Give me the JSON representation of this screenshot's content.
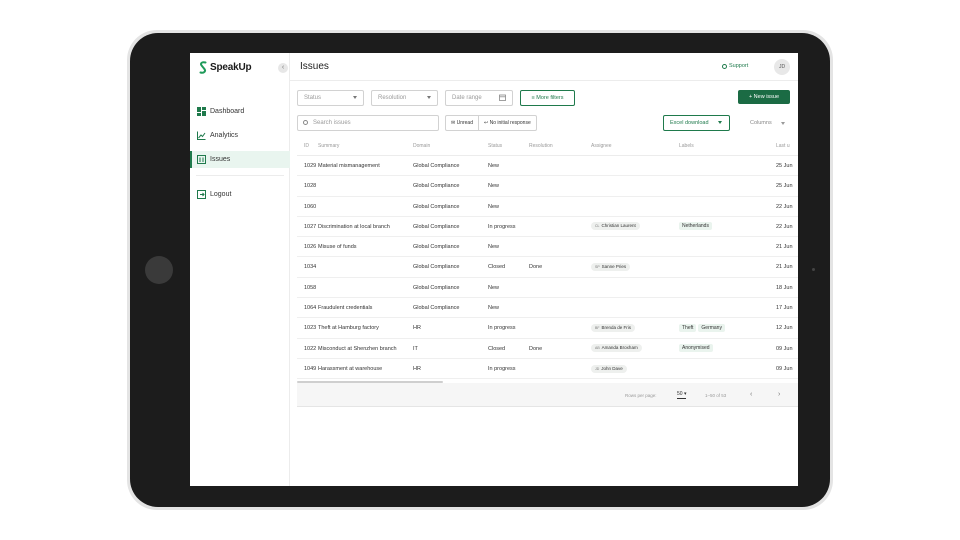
{
  "app": {
    "brand": "SpeakUp",
    "collapse_glyph": "‹",
    "accent": "#1f7a4c"
  },
  "sidebar": {
    "items": [
      {
        "label": "Dashboard",
        "icon": "dashboard-icon"
      },
      {
        "label": "Analytics",
        "icon": "analytics-icon"
      },
      {
        "label": "Issues",
        "icon": "issues-icon",
        "active": true
      }
    ],
    "logout": "Logout"
  },
  "header": {
    "title": "Issues",
    "support": "Support",
    "avatar": "JD"
  },
  "filters": {
    "status": "Status",
    "resolution": "Resolution",
    "date_range": "Date range",
    "more_filters": "More filters",
    "new_issue": "+  New issue",
    "search_placeholder": "Search issues",
    "unread": "Unread",
    "no_initial_response": "No initial response",
    "excel_download": "Excel download",
    "columns": "Columns"
  },
  "table": {
    "headers": [
      "ID",
      "Summary",
      "Domain",
      "Status",
      "Resolution",
      "Assignee",
      "Labels",
      "Last u"
    ],
    "rows": [
      {
        "id": "1029",
        "summary": "Material mismanagement",
        "domain": "Global Compliance",
        "status": "New",
        "resolution": "",
        "assignee": "",
        "assignee_initials": "",
        "labels": [],
        "updated": "25 Jun"
      },
      {
        "id": "1028",
        "summary": "",
        "domain": "Global Compliance",
        "status": "New",
        "resolution": "",
        "assignee": "",
        "assignee_initials": "",
        "labels": [],
        "updated": "25 Jun"
      },
      {
        "id": "1060",
        "summary": "",
        "domain": "Global Compliance",
        "status": "New",
        "resolution": "",
        "assignee": "",
        "assignee_initials": "",
        "labels": [],
        "updated": "22 Jun"
      },
      {
        "id": "1027",
        "summary": "Discrimination at local branch",
        "domain": "Global Compliance",
        "status": "In progress",
        "resolution": "",
        "assignee": "Christian Laurent",
        "assignee_initials": "CL",
        "labels": [
          "Netherlands"
        ],
        "updated": "22 Jun"
      },
      {
        "id": "1026",
        "summary": "Misuse of funds",
        "domain": "Global Compliance",
        "status": "New",
        "resolution": "",
        "assignee": "",
        "assignee_initials": "",
        "labels": [],
        "updated": "21 Jun"
      },
      {
        "id": "1034",
        "summary": "",
        "domain": "Global Compliance",
        "status": "Closed",
        "resolution": "Done",
        "assignee": "Sanne Pries",
        "assignee_initials": "SP",
        "labels": [],
        "updated": "21 Jun"
      },
      {
        "id": "1058",
        "summary": "",
        "domain": "Global Compliance",
        "status": "New",
        "resolution": "",
        "assignee": "",
        "assignee_initials": "",
        "labels": [],
        "updated": "18 Jun"
      },
      {
        "id": "1064",
        "summary": "Fraudulent credentials",
        "domain": "Global Compliance",
        "status": "New",
        "resolution": "",
        "assignee": "",
        "assignee_initials": "",
        "labels": [],
        "updated": "17 Jun"
      },
      {
        "id": "1023",
        "summary": "Theft at Hamburg factory",
        "domain": "HR",
        "status": "In progress",
        "resolution": "",
        "assignee": "Brenda de Fris",
        "assignee_initials": "BF",
        "labels": [
          "Theft",
          "Germany"
        ],
        "updated": "12 Jun"
      },
      {
        "id": "1022",
        "summary": "Misconduct at Shenzhen branch",
        "domain": "IT",
        "status": "Closed",
        "resolution": "Done",
        "assignee": "Amanda Broxham",
        "assignee_initials": "AB",
        "labels": [
          "Anonymised"
        ],
        "updated": "09 Jun"
      },
      {
        "id": "1049",
        "summary": "Harassment at warehouse",
        "domain": "HR",
        "status": "In progress",
        "resolution": "",
        "assignee": "John Dave",
        "assignee_initials": "JD",
        "labels": [],
        "updated": "09 Jun"
      }
    ]
  },
  "pagination": {
    "rows_per_page_label": "Rows per page:",
    "rows_per_page": "50",
    "range": "1–50 of 53",
    "prev": "‹",
    "next": "›"
  }
}
